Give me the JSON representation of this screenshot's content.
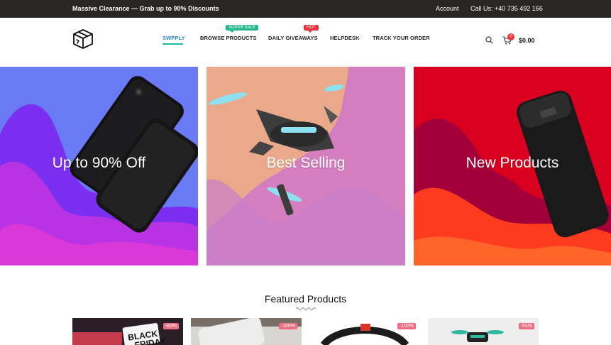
{
  "topbar": {
    "promo": "Massive Clearance — Grab up to 90% Discounts",
    "account": "Account",
    "phone": "Call Us: +40 735 492 166"
  },
  "nav": {
    "items": [
      "SWPPLY",
      "BROWSE PRODUCTS",
      "DAILY GIVEAWAYS",
      "HELPDESK",
      "TRACK YOUR ORDER"
    ],
    "badges": {
      "browse": "SUPER SALE",
      "giveaways": "HOT"
    }
  },
  "cart": {
    "count": "0",
    "total": "$0.00"
  },
  "banners": [
    {
      "label": "Up to 90% Off"
    },
    {
      "label": "Best Selling"
    },
    {
      "label": "New Products"
    }
  ],
  "featured": {
    "title": "Featured Products",
    "products": [
      {
        "discount": "-60%",
        "image_text_1": "BLACK",
        "image_text_2": "FRIDAY"
      },
      {
        "discount": "-100%"
      },
      {
        "discount": "-100%"
      },
      {
        "discount": "-54%"
      }
    ]
  },
  "colors": {
    "topbar": "#2a2626",
    "accent_teal": "#23b8a6",
    "accent_blue": "#2c7fd4",
    "badge_green": "#23b98c",
    "badge_red": "#e8333b",
    "discount_pink": "#ee6b80"
  }
}
